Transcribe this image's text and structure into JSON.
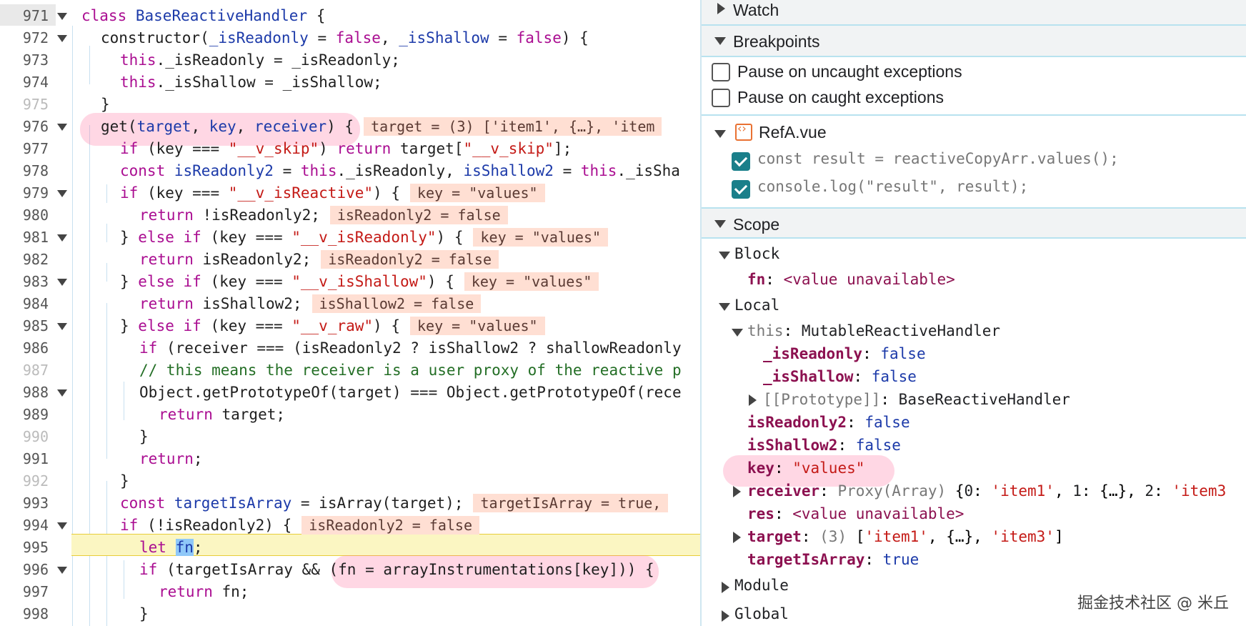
{
  "editor": {
    "lines": [
      {
        "n": "971",
        "fold": true
      },
      {
        "n": "972",
        "fold": true
      },
      {
        "n": "973"
      },
      {
        "n": "974"
      },
      {
        "n": "975"
      },
      {
        "n": "976",
        "fold": true
      },
      {
        "n": "977"
      },
      {
        "n": "978"
      },
      {
        "n": "979",
        "fold": true
      },
      {
        "n": "980"
      },
      {
        "n": "981",
        "fold": true
      },
      {
        "n": "982"
      },
      {
        "n": "983",
        "fold": true
      },
      {
        "n": "984"
      },
      {
        "n": "985",
        "fold": true
      },
      {
        "n": "986"
      },
      {
        "n": "987"
      },
      {
        "n": "988",
        "fold": true
      },
      {
        "n": "989"
      },
      {
        "n": "990"
      },
      {
        "n": "991"
      },
      {
        "n": "992"
      },
      {
        "n": "993"
      },
      {
        "n": "994",
        "fold": true
      },
      {
        "n": "995"
      },
      {
        "n": "996",
        "fold": true
      },
      {
        "n": "997"
      },
      {
        "n": "998"
      }
    ],
    "inline": {
      "l976": "target = (3) ['item1', {…}, 'item",
      "l979": "key = \"values\"",
      "l980": "isReadonly2 = false",
      "l981": "key = \"values\"",
      "l982": "isReadonly2 = false",
      "l983": "key = \"values\"",
      "l984": "isShallow2 = false",
      "l985": "key = \"values\"",
      "l993": "targetIsArray = true,",
      "l994": "isReadonly2 = false"
    }
  },
  "panel": {
    "watch": "Watch",
    "breakpoints": "Breakpoints",
    "pause_uncaught": "Pause on uncaught exceptions",
    "pause_caught": "Pause on caught exceptions",
    "file": "RefA.vue",
    "bp1": "const result = reactiveCopyArr.values();",
    "bp2": "console.log(\"result\", result);",
    "scope": "Scope",
    "block": "Block",
    "local": "Local",
    "module": "Module",
    "global": "Global"
  },
  "colors": {
    "current_line": "#fbf6c2",
    "inline_value": "#ffdfd3",
    "highlight_pill": "#ff6f9e",
    "checkbox": "#1a7f8a"
  },
  "watermark": "掘金技术社区 @ 米丘"
}
